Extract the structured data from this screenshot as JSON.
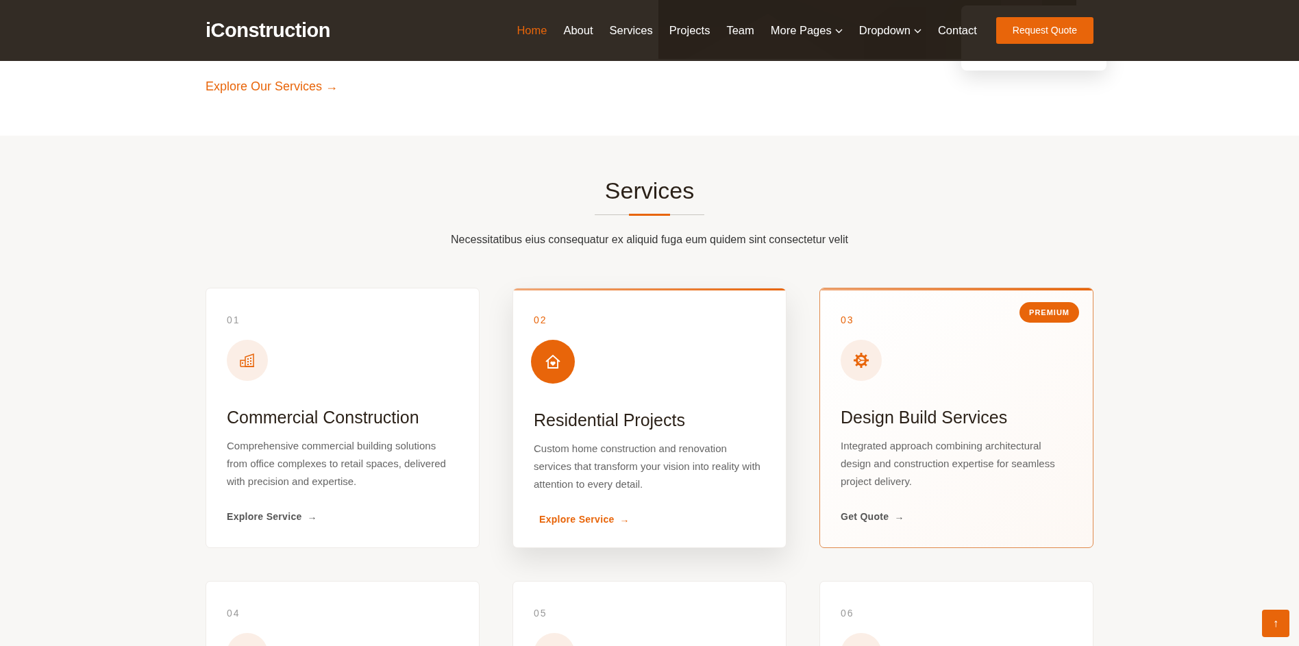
{
  "header": {
    "logo": "iConstruction",
    "nav": [
      {
        "label": "Home",
        "selected": true,
        "dropdown": false
      },
      {
        "label": "About",
        "selected": false,
        "dropdown": false
      },
      {
        "label": "Services",
        "selected": false,
        "dropdown": false
      },
      {
        "label": "Projects",
        "selected": false,
        "dropdown": false
      },
      {
        "label": "Team",
        "selected": false,
        "dropdown": false
      },
      {
        "label": "More Pages",
        "selected": false,
        "dropdown": true
      },
      {
        "label": "Dropdown",
        "selected": false,
        "dropdown": true
      },
      {
        "label": "Contact",
        "selected": false,
        "dropdown": false
      }
    ],
    "button": "Request Quote"
  },
  "hero": {
    "link": "Explore Our Services →"
  },
  "services": {
    "title": "Services",
    "subtitle": "Necessitatibus eius consequatur ex aliquid fuga eum quidem sint consectetur velit",
    "cards": [
      {
        "kind": "plain",
        "number": "01",
        "title": "Commercial Construction",
        "text": "Comprehensive commercial building solutions from office complexes to retail spaces, delivered with precision and expertise.",
        "link": "Explore Service",
        "arrow": "→"
      },
      {
        "kind": "active",
        "number": "02",
        "title": "Residential Projects",
        "text": "Custom home construction and renovation services that transform your vision into reality with attention to every detail.",
        "link": "Explore Service",
        "arrow": "→"
      },
      {
        "kind": "premium",
        "number": "03",
        "badge": "PREMIUM",
        "title": "Design Build Services",
        "text": "Integrated approach combining architectural design and construction expertise for seamless project delivery.",
        "link": "Get Quote",
        "arrow": "→"
      },
      {
        "kind": "plain",
        "number": "04"
      },
      {
        "kind": "plain",
        "number": "05"
      },
      {
        "kind": "plain",
        "number": "06"
      }
    ]
  },
  "scroll_top": "↑"
}
